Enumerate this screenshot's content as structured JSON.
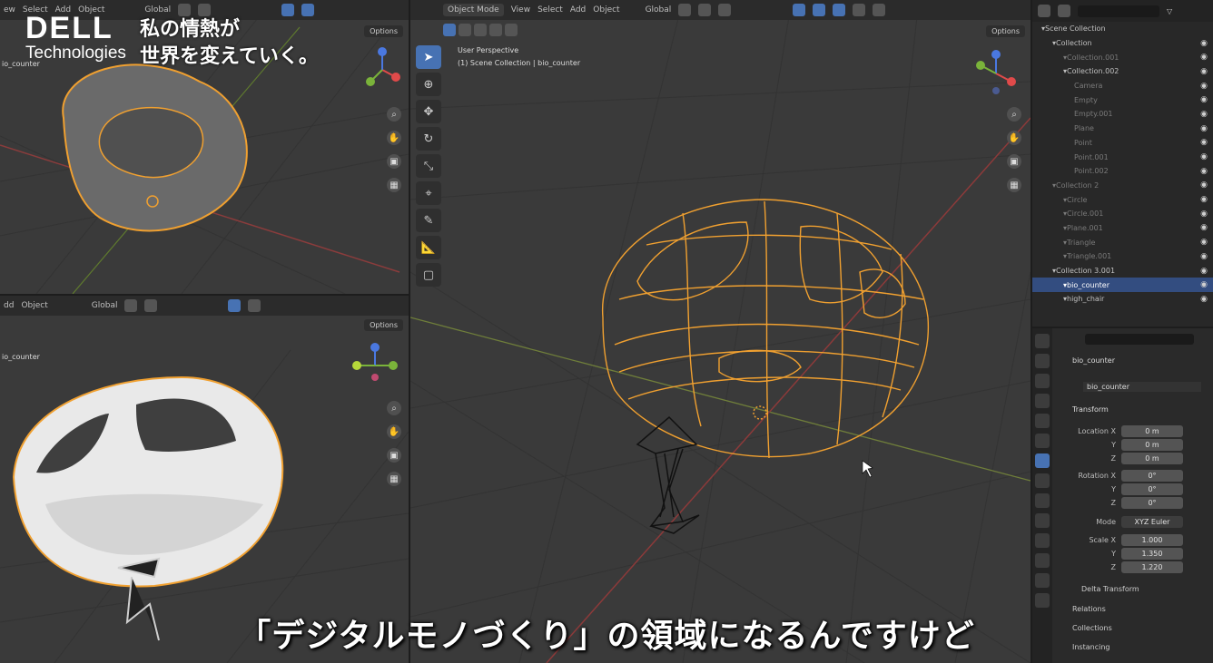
{
  "brand": {
    "logo_top": "DELL",
    "logo_bottom": "Technologies",
    "slogan_line1": "私の情熱が",
    "slogan_line2": "世界を変えていく。"
  },
  "subtitle": "「デジタルモノづくり」の領域になるんですけど",
  "top_left_viewport": {
    "menu": [
      "ew",
      "Select",
      "Add",
      "Object"
    ],
    "transform": "Global",
    "options": "Options",
    "object_label": "io_counter"
  },
  "bottom_left_viewport": {
    "menu": [
      "dd",
      "Object"
    ],
    "transform": "Global",
    "options": "Options",
    "object_label": "io_counter"
  },
  "main_viewport": {
    "mode": "Object Mode",
    "menu": [
      "View",
      "Select",
      "Add",
      "Object"
    ],
    "transform": "Global",
    "options": "Options",
    "perspective": "User Perspective",
    "collection_path": "(1) Scene Collection | bio_counter"
  },
  "outliner": {
    "rows": [
      {
        "label": "Scene Collection",
        "indent": 0,
        "state": "normal"
      },
      {
        "label": "Collection",
        "indent": 1,
        "state": "normal"
      },
      {
        "label": "Collection.001",
        "indent": 2,
        "state": "dim"
      },
      {
        "label": "Collection.002",
        "indent": 2,
        "state": "normal"
      },
      {
        "label": "Camera",
        "indent": 3,
        "state": "dim"
      },
      {
        "label": "Empty",
        "indent": 3,
        "state": "dim"
      },
      {
        "label": "Empty.001",
        "indent": 3,
        "state": "dim"
      },
      {
        "label": "Plane",
        "indent": 3,
        "state": "dim"
      },
      {
        "label": "Point",
        "indent": 3,
        "state": "dim"
      },
      {
        "label": "Point.001",
        "indent": 3,
        "state": "dim"
      },
      {
        "label": "Point.002",
        "indent": 3,
        "state": "dim"
      },
      {
        "label": "Collection 2",
        "indent": 1,
        "state": "dim"
      },
      {
        "label": "Circle",
        "indent": 2,
        "state": "dim"
      },
      {
        "label": "Circle.001",
        "indent": 2,
        "state": "dim"
      },
      {
        "label": "Plane.001",
        "indent": 2,
        "state": "dim"
      },
      {
        "label": "Triangle",
        "indent": 2,
        "state": "dim"
      },
      {
        "label": "Triangle.001",
        "indent": 2,
        "state": "dim"
      },
      {
        "label": "Collection 3.001",
        "indent": 1,
        "state": "normal"
      },
      {
        "label": "bio_counter",
        "indent": 2,
        "state": "sel"
      },
      {
        "label": "high_chair",
        "indent": 2,
        "state": "normal"
      }
    ]
  },
  "properties": {
    "object_name": "bio_counter",
    "data_name": "bio_counter",
    "transform_header": "Transform",
    "location": {
      "label_x": "Location X",
      "x": "0 m",
      "y": "0 m",
      "z": "0 m"
    },
    "rotation": {
      "label_x": "Rotation X",
      "x": "0°",
      "y": "0°",
      "z": "0°"
    },
    "mode_label": "Mode",
    "mode_value": "XYZ Euler",
    "scale": {
      "label_x": "Scale X",
      "x": "1.000",
      "y": "1.350",
      "z": "1.220"
    },
    "axis_y": "Y",
    "axis_z": "Z",
    "sections": [
      "Delta Transform",
      "Relations",
      "Collections",
      "Instancing"
    ]
  },
  "colors": {
    "accent": "#4772b3",
    "selection_orange": "#f0a030",
    "grid_bg": "#3a3a3a"
  }
}
